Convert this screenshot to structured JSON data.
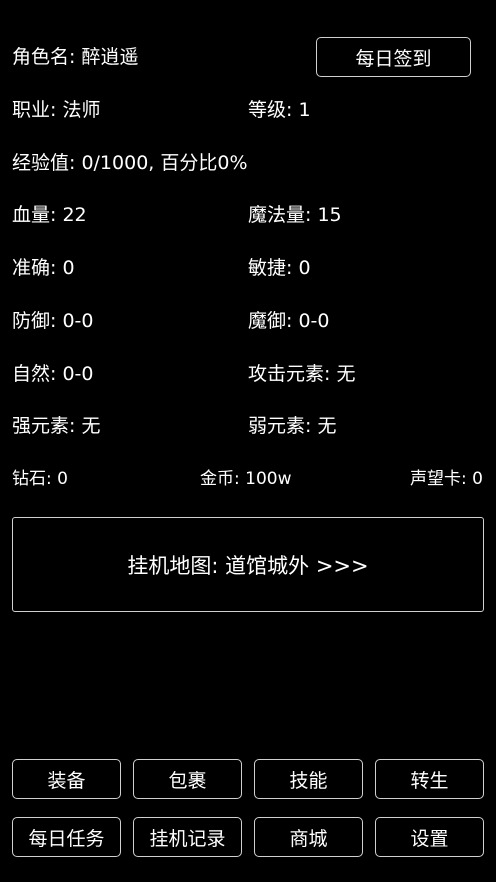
{
  "character": {
    "name_label": "角色名: 醉逍遥",
    "checkin_button": "每日签到",
    "job": "职业: 法师",
    "level": "等级: 1",
    "exp": "经验值: 0/1000,  百分比0%",
    "hp": "血量: 22",
    "mp": "魔法量: 15",
    "accuracy": "准确: 0",
    "agility": "敏捷: 0",
    "defense": "防御: 0-0",
    "magic_defense": "魔御: 0-0",
    "nature": "自然: 0-0",
    "attack_element": "攻击元素: 无",
    "strong_element": "强元素: 无",
    "weak_element": "弱元素: 无"
  },
  "currency": {
    "diamond": "钻石: 0",
    "gold": "金币: 100w",
    "reputation": "声望卡: 0"
  },
  "map_button": "挂机地图: 道馆城外 >>>",
  "menu": {
    "equipment": "装备",
    "bag": "包裹",
    "skills": "技能",
    "rebirth": "转生",
    "daily_tasks": "每日任务",
    "idle_log": "挂机记录",
    "shop": "商城",
    "settings": "设置"
  }
}
